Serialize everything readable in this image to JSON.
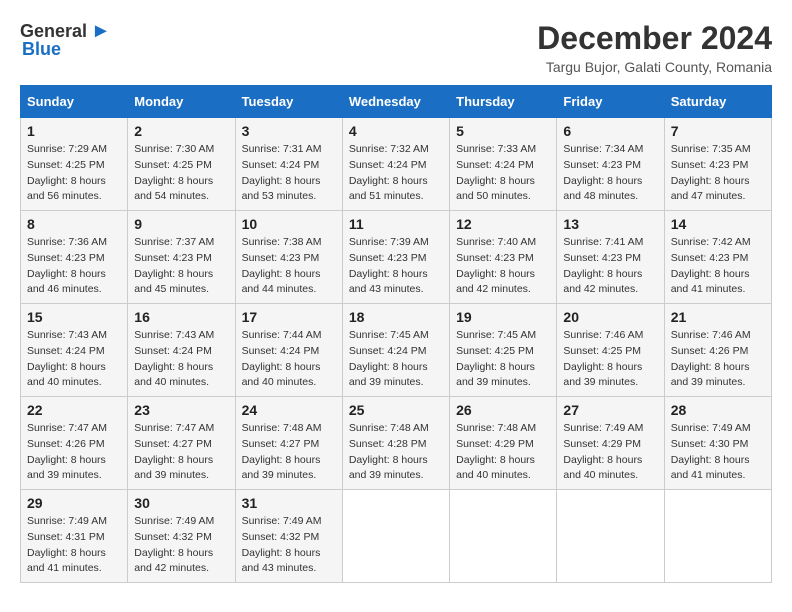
{
  "header": {
    "logo_general": "General",
    "logo_blue": "Blue",
    "title": "December 2024",
    "subtitle": "Targu Bujor, Galati County, Romania"
  },
  "calendar": {
    "days_of_week": [
      "Sunday",
      "Monday",
      "Tuesday",
      "Wednesday",
      "Thursday",
      "Friday",
      "Saturday"
    ],
    "weeks": [
      [
        null,
        {
          "num": "2",
          "sunrise": "7:30 AM",
          "sunset": "4:25 PM",
          "daylight": "8 hours and 54 minutes."
        },
        {
          "num": "3",
          "sunrise": "7:31 AM",
          "sunset": "4:24 PM",
          "daylight": "8 hours and 53 minutes."
        },
        {
          "num": "4",
          "sunrise": "7:32 AM",
          "sunset": "4:24 PM",
          "daylight": "8 hours and 51 minutes."
        },
        {
          "num": "5",
          "sunrise": "7:33 AM",
          "sunset": "4:24 PM",
          "daylight": "8 hours and 50 minutes."
        },
        {
          "num": "6",
          "sunrise": "7:34 AM",
          "sunset": "4:23 PM",
          "daylight": "8 hours and 48 minutes."
        },
        {
          "num": "7",
          "sunrise": "7:35 AM",
          "sunset": "4:23 PM",
          "daylight": "8 hours and 47 minutes."
        }
      ],
      [
        {
          "num": "1",
          "sunrise": "7:29 AM",
          "sunset": "4:25 PM",
          "daylight": "8 hours and 56 minutes."
        },
        {
          "num": "9",
          "sunrise": "7:37 AM",
          "sunset": "4:23 PM",
          "daylight": "8 hours and 45 minutes."
        },
        {
          "num": "10",
          "sunrise": "7:38 AM",
          "sunset": "4:23 PM",
          "daylight": "8 hours and 44 minutes."
        },
        {
          "num": "11",
          "sunrise": "7:39 AM",
          "sunset": "4:23 PM",
          "daylight": "8 hours and 43 minutes."
        },
        {
          "num": "12",
          "sunrise": "7:40 AM",
          "sunset": "4:23 PM",
          "daylight": "8 hours and 42 minutes."
        },
        {
          "num": "13",
          "sunrise": "7:41 AM",
          "sunset": "4:23 PM",
          "daylight": "8 hours and 42 minutes."
        },
        {
          "num": "14",
          "sunrise": "7:42 AM",
          "sunset": "4:23 PM",
          "daylight": "8 hours and 41 minutes."
        }
      ],
      [
        {
          "num": "8",
          "sunrise": "7:36 AM",
          "sunset": "4:23 PM",
          "daylight": "8 hours and 46 minutes."
        },
        {
          "num": "16",
          "sunrise": "7:43 AM",
          "sunset": "4:24 PM",
          "daylight": "8 hours and 40 minutes."
        },
        {
          "num": "17",
          "sunrise": "7:44 AM",
          "sunset": "4:24 PM",
          "daylight": "8 hours and 40 minutes."
        },
        {
          "num": "18",
          "sunrise": "7:45 AM",
          "sunset": "4:24 PM",
          "daylight": "8 hours and 39 minutes."
        },
        {
          "num": "19",
          "sunrise": "7:45 AM",
          "sunset": "4:25 PM",
          "daylight": "8 hours and 39 minutes."
        },
        {
          "num": "20",
          "sunrise": "7:46 AM",
          "sunset": "4:25 PM",
          "daylight": "8 hours and 39 minutes."
        },
        {
          "num": "21",
          "sunrise": "7:46 AM",
          "sunset": "4:26 PM",
          "daylight": "8 hours and 39 minutes."
        }
      ],
      [
        {
          "num": "15",
          "sunrise": "7:43 AM",
          "sunset": "4:24 PM",
          "daylight": "8 hours and 40 minutes."
        },
        {
          "num": "23",
          "sunrise": "7:47 AM",
          "sunset": "4:27 PM",
          "daylight": "8 hours and 39 minutes."
        },
        {
          "num": "24",
          "sunrise": "7:48 AM",
          "sunset": "4:27 PM",
          "daylight": "8 hours and 39 minutes."
        },
        {
          "num": "25",
          "sunrise": "7:48 AM",
          "sunset": "4:28 PM",
          "daylight": "8 hours and 39 minutes."
        },
        {
          "num": "26",
          "sunrise": "7:48 AM",
          "sunset": "4:29 PM",
          "daylight": "8 hours and 40 minutes."
        },
        {
          "num": "27",
          "sunrise": "7:49 AM",
          "sunset": "4:29 PM",
          "daylight": "8 hours and 40 minutes."
        },
        {
          "num": "28",
          "sunrise": "7:49 AM",
          "sunset": "4:30 PM",
          "daylight": "8 hours and 41 minutes."
        }
      ],
      [
        {
          "num": "22",
          "sunrise": "7:47 AM",
          "sunset": "4:26 PM",
          "daylight": "8 hours and 39 minutes."
        },
        {
          "num": "30",
          "sunrise": "7:49 AM",
          "sunset": "4:32 PM",
          "daylight": "8 hours and 42 minutes."
        },
        {
          "num": "31",
          "sunrise": "7:49 AM",
          "sunset": "4:32 PM",
          "daylight": "8 hours and 43 minutes."
        },
        null,
        null,
        null,
        null
      ],
      [
        {
          "num": "29",
          "sunrise": "7:49 AM",
          "sunset": "4:31 PM",
          "daylight": "8 hours and 41 minutes."
        },
        null,
        null,
        null,
        null,
        null,
        null
      ]
    ]
  }
}
